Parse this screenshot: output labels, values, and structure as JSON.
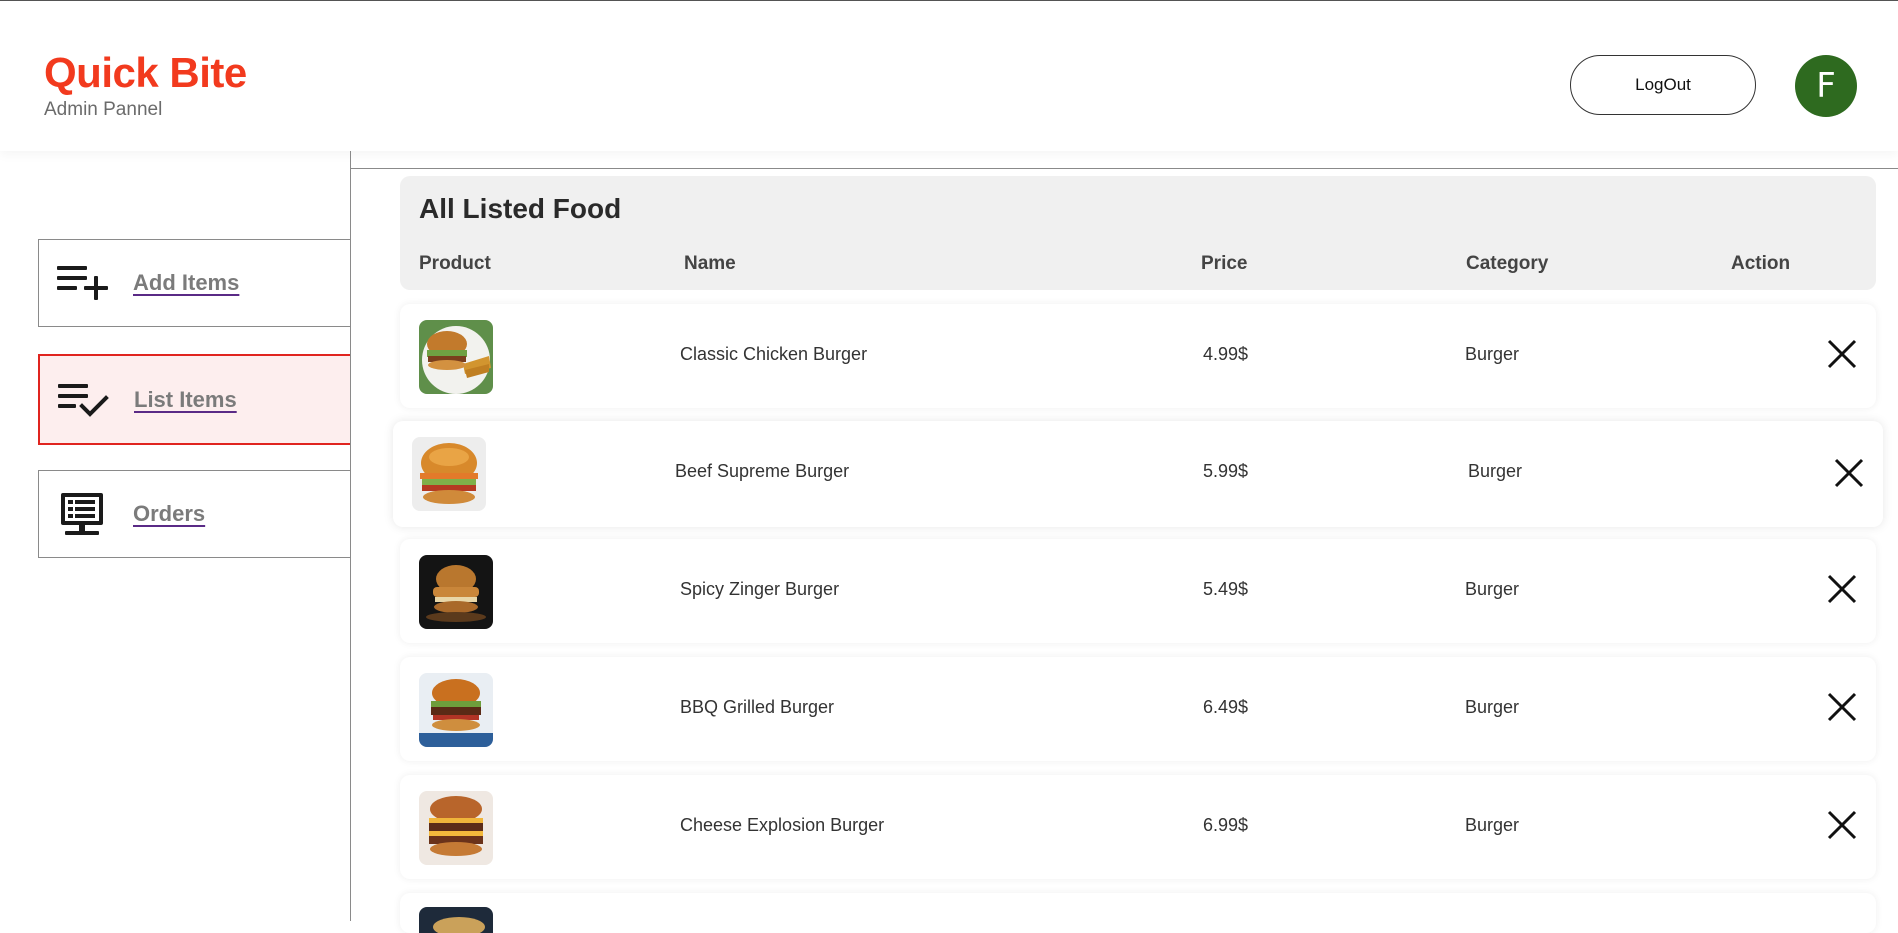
{
  "header": {
    "brand_title": "Quick Bite",
    "brand_subtitle": "Admin Pannel",
    "logout_label": "LogOut",
    "avatar_initial": "F",
    "brand_color": "#f23a1e",
    "avatar_color": "#2e6a1f"
  },
  "sidebar": {
    "items": [
      {
        "label": "Add Items",
        "icon": "add-list-icon",
        "active": false
      },
      {
        "label": "List Items",
        "icon": "checklist-icon",
        "active": true
      },
      {
        "label": "Orders",
        "icon": "monitor-orders-icon",
        "active": false
      }
    ]
  },
  "table": {
    "title": "All Listed Food",
    "columns": [
      "Product",
      "Name",
      "Price",
      "Category",
      "Action"
    ],
    "rows": [
      {
        "name": "Classic Chicken Burger",
        "price": "4.99$",
        "category": "Burger",
        "image": "burger-with-fries-image"
      },
      {
        "name": "Beef Supreme Burger",
        "price": "5.99$",
        "category": "Burger",
        "image": "crispy-burger-image"
      },
      {
        "name": "Spicy Zinger Burger",
        "price": "5.49$",
        "category": "Burger",
        "image": "zinger-burger-image"
      },
      {
        "name": "BBQ Grilled Burger",
        "price": "6.49$",
        "category": "Burger",
        "image": "bbq-burger-image"
      },
      {
        "name": "Cheese Explosion Burger",
        "price": "6.99$",
        "category": "Burger",
        "image": "cheese-burger-image"
      }
    ]
  }
}
